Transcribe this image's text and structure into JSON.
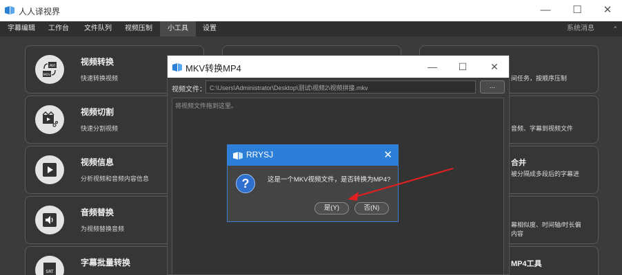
{
  "app": {
    "title": "人人译视界",
    "window_controls": [
      "—",
      "☐",
      "✕"
    ]
  },
  "menu": {
    "items": [
      "字幕编辑",
      "工作台",
      "文件队列",
      "视频压制",
      "小工具",
      "设置"
    ],
    "active": "小工具",
    "system_messages": "系统消息",
    "caret": "⌃"
  },
  "cards": [
    {
      "title": "视频转换",
      "desc": "快速转换视频",
      "icon": "avi-convert-icon"
    },
    {
      "title": "视频切割",
      "desc": "快速分割视频",
      "icon": "video-cut-icon"
    },
    {
      "title": "视频信息",
      "desc": "分析视频和音频内容信息",
      "icon": "play-icon"
    },
    {
      "title": "音频替换",
      "desc": "为视频替换音频",
      "icon": "audio-icon"
    },
    {
      "title": "字幕批量转换",
      "desc": "",
      "icon": "srt-icon"
    }
  ],
  "right_partial": {
    "r1": "间任务，按顺序压制",
    "r2": "音频、字幕到视频文件",
    "r3_title": "合并",
    "r3_desc": "被分隔成多段后的字幕进",
    "r4a": "幕相似度、时间轴/时长偏",
    "r4b": "内容",
    "r5_title": "MP4工具"
  },
  "mkv_dialog": {
    "title": "MKV转换MP4",
    "file_label": "视频文件：",
    "file_path": "C:\\Users\\Administrator\\Desktop\\测试\\视频2\\视频拼接.mkv",
    "browse_label": "...",
    "drop_hint": "将视频文件拖到这里。",
    "controls": [
      "—",
      "☐",
      "✕"
    ]
  },
  "message_box": {
    "title": "RRYSJ",
    "close": "✕",
    "icon_glyph": "?",
    "text": "这是一个MKV视频文件，是否转换为MP4?",
    "yes_label": "是(Y)",
    "no_label": "否(N)"
  },
  "colors": {
    "accent_blue": "#2d7ed8",
    "arrow_red": "#e02020",
    "background": "#3b3b3b"
  }
}
